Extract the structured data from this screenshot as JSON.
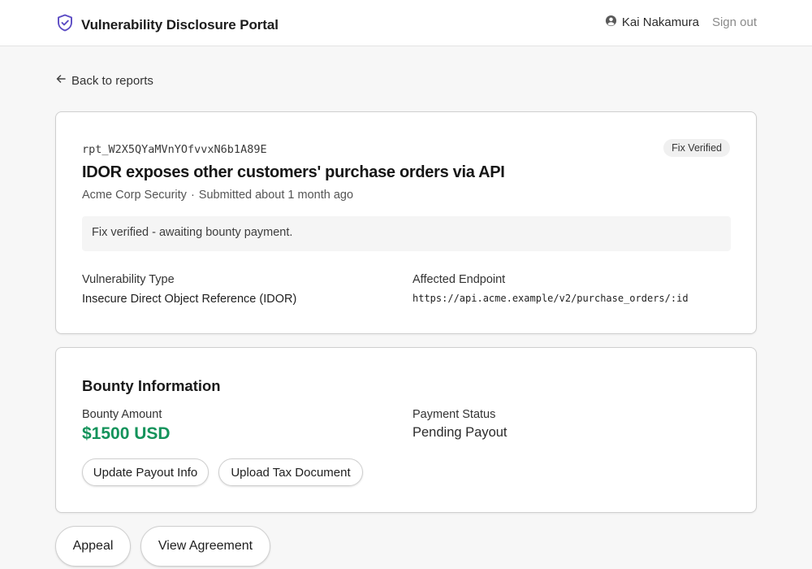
{
  "header": {
    "title": "Vulnerability Disclosure Portal",
    "logo_icon": "shield-check-icon",
    "user_icon": "user-circle-icon",
    "user_name": "Kai Nakamura",
    "signout_label": "Sign out"
  },
  "nav": {
    "back_label": "Back to reports",
    "back_icon": "arrow-left-icon"
  },
  "report": {
    "id": "rpt_W2X5QYaMVnYOfvvxN6b1A89E",
    "status_badge": "Fix Verified",
    "title": "IDOR exposes other customers' purchase orders via API",
    "org": "Acme Corp Security",
    "separator": "·",
    "submitted": "Submitted about 1 month ago",
    "notice": "Fix verified - awaiting bounty payment.",
    "vuln_type_label": "Vulnerability Type",
    "vuln_type_value": "Insecure Direct Object Reference (IDOR)",
    "endpoint_label": "Affected Endpoint",
    "endpoint_value": "https://api.acme.example/v2/purchase_orders/:id"
  },
  "bounty": {
    "section_title": "Bounty Information",
    "amount_label": "Bounty Amount",
    "amount_value": "$1500 USD",
    "status_label": "Payment Status",
    "status_value": "Pending Payout",
    "update_payout_label": "Update Payout Info",
    "upload_tax_label": "Upload Tax Document"
  },
  "actions": {
    "appeal_label": "Appeal",
    "view_agreement_label": "View Agreement"
  },
  "colors": {
    "accent": "#5b4bc4",
    "amount_green": "#14935b"
  }
}
